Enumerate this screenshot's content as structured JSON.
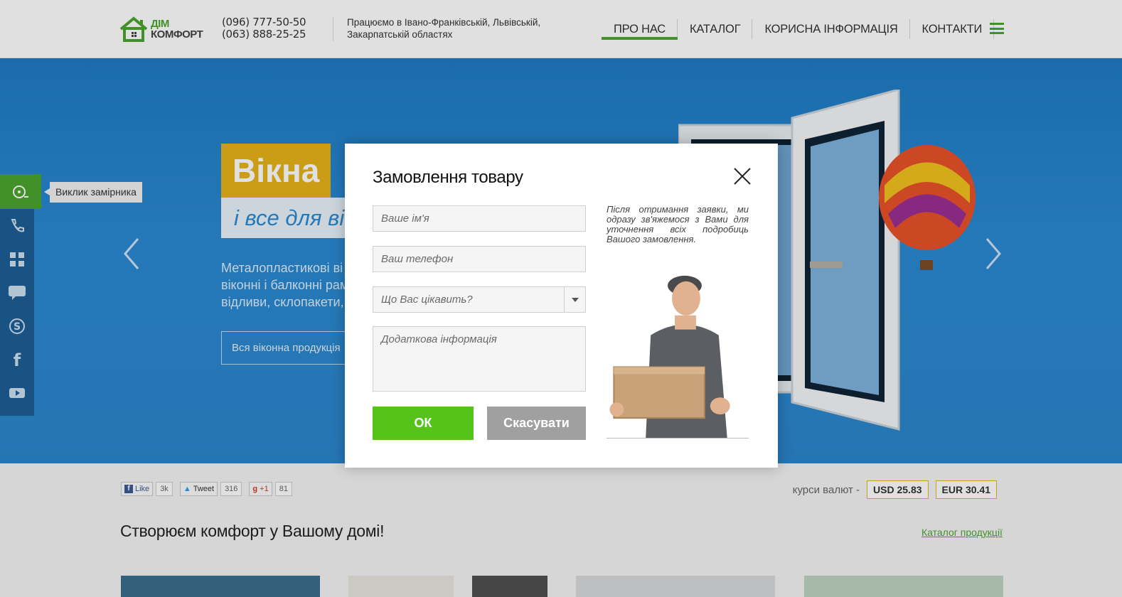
{
  "brand": {
    "line1": "ДІМ",
    "line2": "КОМФОРТ"
  },
  "phones": [
    "(096) 777-50-50",
    "(063) 888-25-25"
  ],
  "regions": "Працюємо в Івано-Франківській, Львівській, Закарпатській областях",
  "nav": {
    "items": [
      {
        "label": "ПРО НАС",
        "active": true
      },
      {
        "label": "КАТАЛОГ",
        "active": false
      },
      {
        "label": "КОРИСНА ІНФОРМАЦІЯ",
        "active": false
      },
      {
        "label": "КОНТАКТИ",
        "active": false
      }
    ]
  },
  "hero": {
    "title": "Вікна",
    "subtitle": "і все для ві",
    "text": [
      "Металопластикові ві",
      "віконні і балконні рам",
      "відливи, склопакети,"
    ],
    "button": "Вся віконна продукція"
  },
  "sidebar": {
    "tooltip": "Виклик замірника",
    "icons": [
      "measure-call-icon",
      "phone-icon",
      "catalog-grid-icon",
      "chat-icon",
      "skype-icon",
      "facebook-icon",
      "youtube-icon"
    ]
  },
  "social": {
    "like": {
      "label": "Like",
      "count": "3k"
    },
    "tweet": {
      "label": "Tweet",
      "count": "316"
    },
    "gplus": {
      "label": "+1",
      "count": "81"
    }
  },
  "rates": {
    "label": "курси валют -",
    "usd": "USD 25.83",
    "eur": "EUR 30.41"
  },
  "section": {
    "title": "Створюєм комфорт у Вашому домі!",
    "catalog_link": "Каталог продукції"
  },
  "modal": {
    "title": "Замовлення товару",
    "name_placeholder": "Ваше ім'я",
    "phone_placeholder": "Ваш телефон",
    "interest_placeholder": "Що Вас цікавить?",
    "extra_placeholder": "Додаткова інформація",
    "ok_label": "ОК",
    "cancel_label": "Скасувати",
    "note": "Після отримання заявки, ми одразу зв'яжемося з Вами для уточнення всіх подробиць Вашого замовлення."
  },
  "colors": {
    "accent": "#4aa62e",
    "hero": "#2b8ad3",
    "title_bg": "#e7b21a",
    "ok": "#56c31b",
    "cancel": "#a0a0a0"
  }
}
